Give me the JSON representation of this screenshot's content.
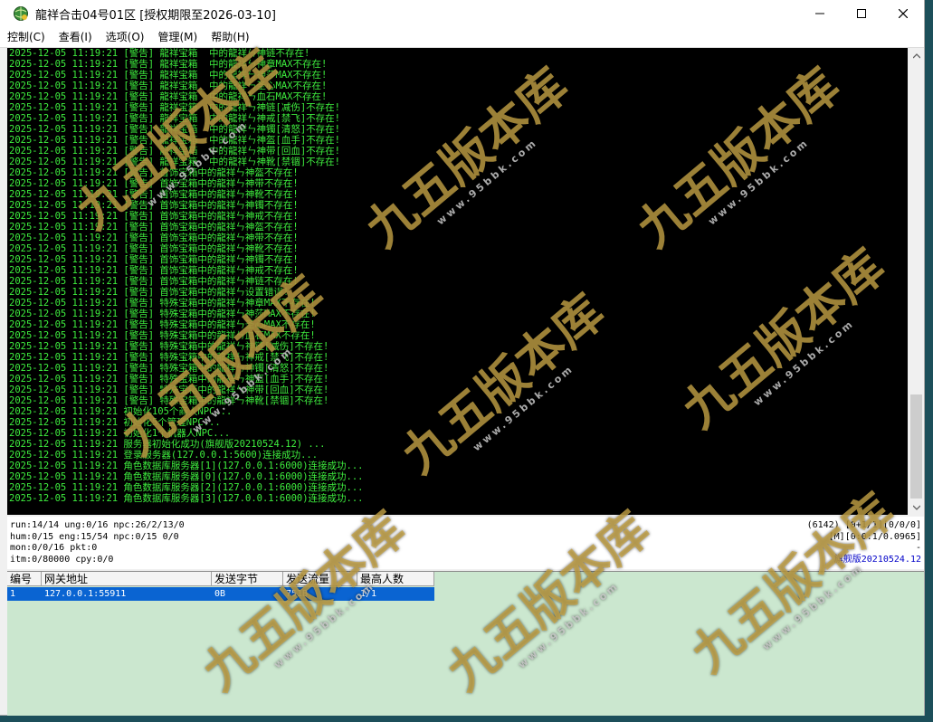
{
  "window": {
    "title": "龍祥合击04号01区 [授权期限至2026-03-10]"
  },
  "menu": [
    "控制(C)",
    "查看(I)",
    "选项(O)",
    "管理(M)",
    "帮助(H)"
  ],
  "log": [
    "2025-12-05 11:19:21 [警告] 龍祥宝箱  中的龍祥ㄣ神链不存在!",
    "2025-12-05 11:19:21 [警告] 龍祥宝箱  中的龍祥ㄣ神章MAX不存在!",
    "2025-12-05 11:19:21 [警告] 龍祥宝箱  中的龍祥ㄣ神莎MAX不存在!",
    "2025-12-05 11:19:21 [警告] 龍祥宝箱  中的龍祥ㄣ圣心MAX不存在!",
    "2025-12-05 11:19:21 [警告] 龍祥宝箱  中的龍祥ㄣ血石MAX不存在!",
    "2025-12-05 11:19:21 [警告] 龍祥宝箱  中的龍祥ㄣ神链[减伤]不存在!",
    "2025-12-05 11:19:21 [警告] 龍祥宝箱  中的龍祥ㄣ神戒[禁飞]不存在!",
    "2025-12-05 11:19:21 [警告] 龍祥宝箱  中的龍祥ㄣ神镯[清怒]不存在!",
    "2025-12-05 11:19:21 [警告] 龍祥宝箱  中的龍祥ㄣ神盔[血手]不存在!",
    "2025-12-05 11:19:21 [警告] 龍祥宝箱  中的龍祥ㄣ神带[回血]不存在!",
    "2025-12-05 11:19:21 [警告] 龍祥宝箱  中的龍祥ㄣ神靴[禁锢]不存在!",
    "2025-12-05 11:19:21 [警告] 首饰宝箱中的龍祥ㄣ神盔不存在!",
    "2025-12-05 11:19:21 [警告] 首饰宝箱中的龍祥ㄣ神带不存在!",
    "2025-12-05 11:19:21 [警告] 首饰宝箱中的龍祥ㄣ神靴不存在!",
    "2025-12-05 11:19:21 [警告] 首饰宝箱中的龍祥ㄣ神镯不存在!",
    "2025-12-05 11:19:21 [警告] 首饰宝箱中的龍祥ㄣ神戒不存在!",
    "2025-12-05 11:19:21 [警告] 首饰宝箱中的龍祥ㄣ神盔不存在!",
    "2025-12-05 11:19:21 [警告] 首饰宝箱中的龍祥ㄣ神带不存在!",
    "2025-12-05 11:19:21 [警告] 首饰宝箱中的龍祥ㄣ神靴不存在!",
    "2025-12-05 11:19:21 [警告] 首饰宝箱中的龍祥ㄣ神镯不存在!",
    "2025-12-05 11:19:21 [警告] 首饰宝箱中的龍祥ㄣ神戒不存在!",
    "2025-12-05 11:19:21 [警告] 首饰宝箱中的龍祥ㄣ神链不存在!",
    "2025-12-05 11:19:21 [警告] 首饰宝箱中的龍祥ㄣ设置错误!",
    "2025-12-05 11:19:21 [警告] 特殊宝箱中的龍祥ㄣ神章MAX不存在!",
    "2025-12-05 11:19:21 [警告] 特殊宝箱中的龍祥ㄣ神莎MAX不存在!",
    "2025-12-05 11:19:21 [警告] 特殊宝箱中的龍祥ㄣ圣心MAX不存在!",
    "2025-12-05 11:19:21 [警告] 特殊宝箱中的龍祥ㄣ血石MAX不存在!",
    "2025-12-05 11:19:21 [警告] 特殊宝箱中的龍祥ㄣ神链[减伤]不存在!",
    "2025-12-05 11:19:21 [警告] 特殊宝箱中的龍祥ㄣ神戒[禁飞]不存在!",
    "2025-12-05 11:19:21 [警告] 特殊宝箱中的龍祥ㄣ神镯[清怒]不存在!",
    "2025-12-05 11:19:21 [警告] 特殊宝箱中的龍祥ㄣ神盔[血手]不存在!",
    "2025-12-05 11:19:21 [警告] 特殊宝箱中的龍祥ㄣ神带[回血]不存在!",
    "2025-12-05 11:19:21 [警告] 特殊宝箱中的龍祥ㄣ神靴[禁锢]不存在!",
    "2025-12-05 11:19:21 初始化105个商人NPC...",
    "2025-12-05 11:19:21 初始化5个管理NPC...",
    "2025-12-05 11:19:21 初始化1个机器人NPC...",
    "2025-12-05 11:19:21 服务器初始化成功(旗舰版20210524.12) ...",
    "2025-12-05 11:19:21 登录服务器(127.0.0.1:5600)连接成功...",
    "2025-12-05 11:19:21 角色数据库服务器[1](127.0.0.1:6000)连接成功...",
    "2025-12-05 11:19:21 角色数据库服务器[0](127.0.0.1:6000)连接成功...",
    "2025-12-05 11:19:21 角色数据库服务器[2](127.0.0.1:6000)连接成功...",
    "2025-12-05 11:19:21 角色数据库服务器[3](127.0.0.1:6000)连接成功..."
  ],
  "status": {
    "left": [
      "run:14/14 ung:0/16 npc:26/2/13/0",
      "hum:0/15 eng:15/54 npc:0/15 0/0",
      "mon:0/0/16 pkt:0",
      "itm:0/80000 cpy:0/0"
    ],
    "right": [
      "(6142) [0+1/1][0/0/0]",
      "[M][0:0:1/0.0965]",
      "-",
      "旗舰版20210524.12"
    ]
  },
  "table": {
    "headers": [
      "编号",
      "网关地址",
      "发送字节",
      "发送流量",
      "最高人数"
    ],
    "rows": [
      [
        "1",
        "127.0.0.1:55911",
        "0B",
        "751B",
        "1/1"
      ]
    ]
  },
  "watermark": {
    "text": "九五版本库",
    "sub": "www.95bbk.com"
  }
}
